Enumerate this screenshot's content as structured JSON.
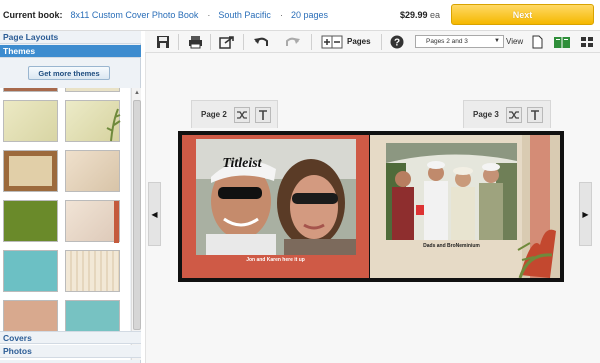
{
  "topbar": {
    "current_book_label": "Current book:",
    "book_title": "8x11 Custom Cover Photo Book",
    "theme": "South Pacific",
    "pages": "20 pages",
    "separator": "·",
    "price": "$29.99",
    "price_unit": "ea",
    "next_label": "Next",
    "next_color": "#f5b800"
  },
  "sidebar": {
    "page_layouts_label": "Page Layouts",
    "themes_label": "Themes",
    "get_more_label": "Get more themes",
    "covers_label": "Covers",
    "photos_label": "Photos",
    "active_color": "#3d8ccf"
  },
  "toolbar": {
    "icons": [
      "save-icon",
      "print-icon",
      "share-icon",
      "undo-icon",
      "redo-icon",
      "add-remove-pages-icon",
      "help-icon",
      "single-page-view-icon",
      "two-page-view-icon",
      "grid-view-icon"
    ],
    "pages_label": "Pages",
    "page_select_value": "Pages 2 and 3",
    "view_label": "View"
  },
  "canvas": {
    "page_left_label": "Page 2",
    "page_right_label": "Page 3",
    "caption_left": "Jon and Karen here it up",
    "caption_right": "Dads and BroNeminium",
    "left_page_color": "#cf5a46",
    "right_page_color": "#e8dcc9",
    "cap_text": "Titleist"
  }
}
